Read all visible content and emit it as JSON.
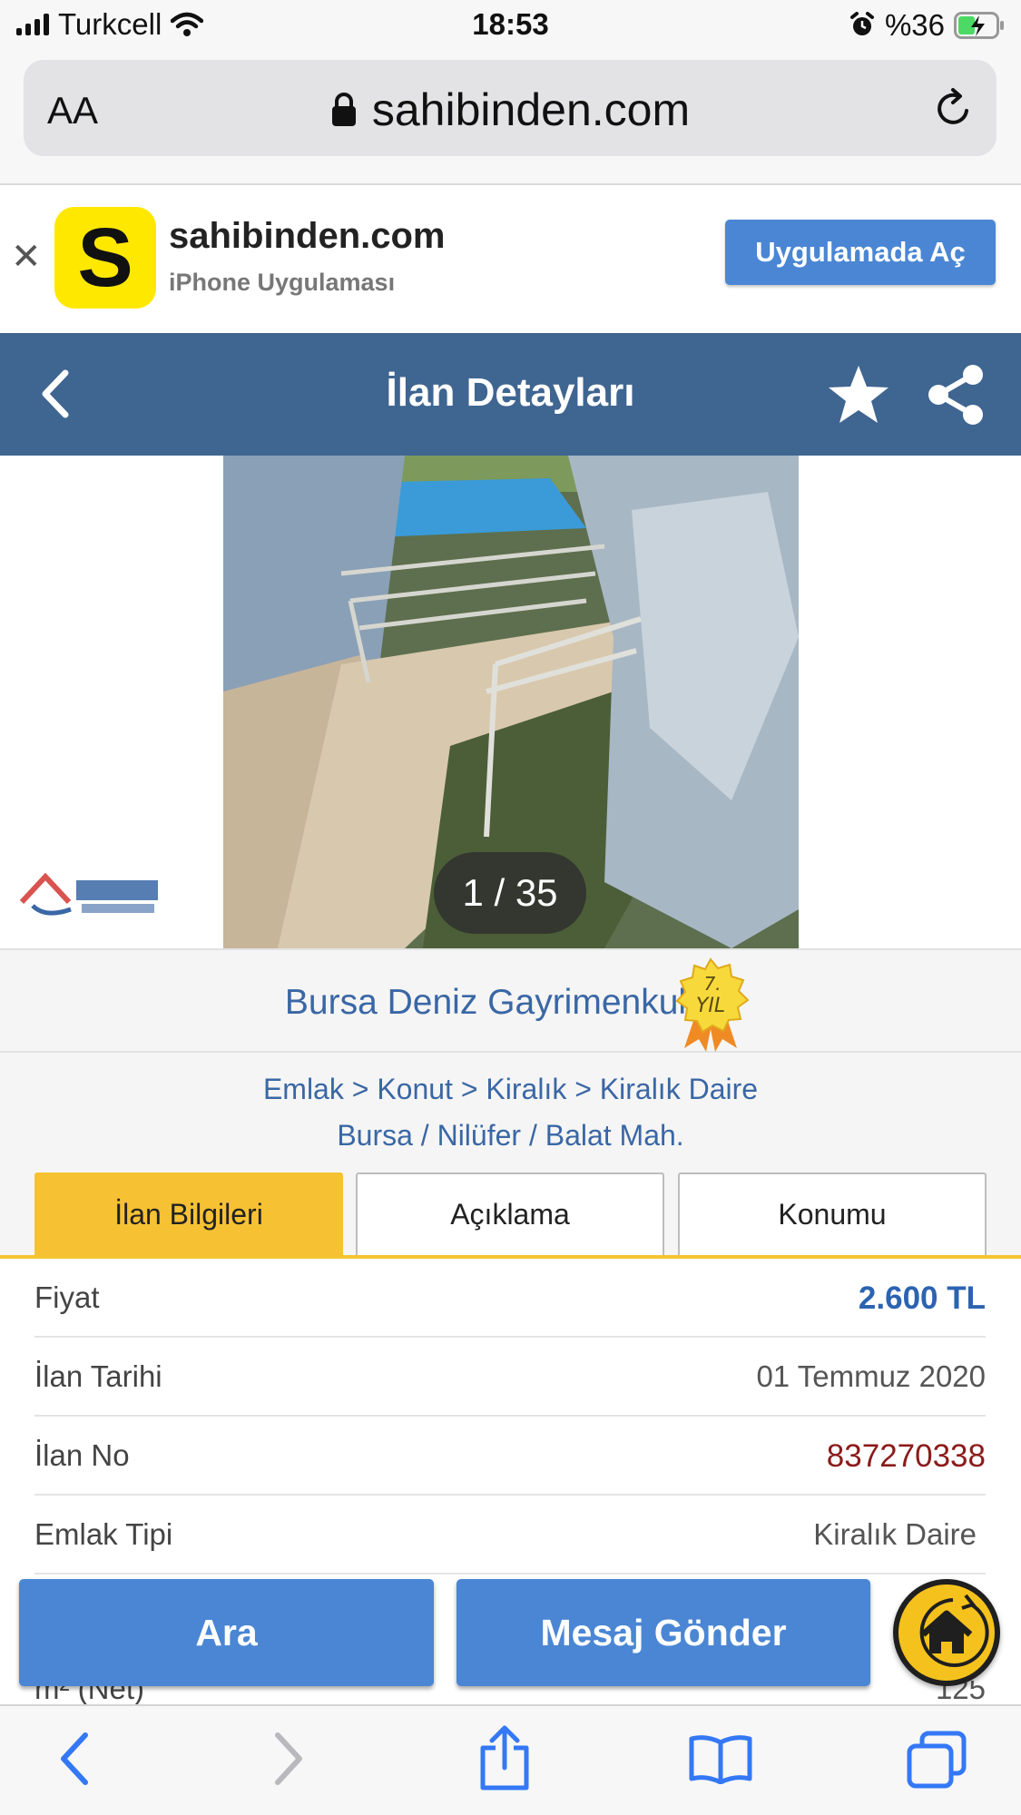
{
  "status_bar": {
    "carrier": "Turkcell",
    "time": "18:53",
    "battery": "%36"
  },
  "browser": {
    "text_size": "AA",
    "url": "sahibinden.com"
  },
  "app_banner": {
    "name": "sahibinden.com",
    "subtitle": "iPhone Uygulaması",
    "logo_letter": "S",
    "open_label": "Uygulamada Aç"
  },
  "header": {
    "title": "İlan Detayları"
  },
  "gallery": {
    "counter": "1 / 35"
  },
  "store": {
    "name": "Bursa Deniz Gayrimenkul",
    "badge": "7. YIL"
  },
  "breadcrumb": {
    "path": "Emlak > Konut > Kiralık > Kiralık Daire",
    "location": "Bursa / Nilüfer / Balat Mah."
  },
  "tabs": [
    {
      "label": "İlan Bilgileri",
      "active": true
    },
    {
      "label": "Açıklama",
      "active": false
    },
    {
      "label": "Konumu",
      "active": false
    }
  ],
  "details": [
    {
      "key": "Fiyat",
      "value": "2.600 TL"
    },
    {
      "key": "İlan Tarihi",
      "value": "01 Temmuz 2020"
    },
    {
      "key": "İlan No",
      "value": "837270338"
    },
    {
      "key": "Emlak Tipi",
      "value": "Kiralık Daire"
    },
    {
      "key": "m² (Net)",
      "value": "125"
    }
  ],
  "actions": {
    "call": "Ara",
    "message": "Mesaj Gönder"
  },
  "colors": {
    "header": "#3f6591",
    "button": "#4a86d4",
    "accent": "#f6c233",
    "link": "#3a67a5"
  }
}
